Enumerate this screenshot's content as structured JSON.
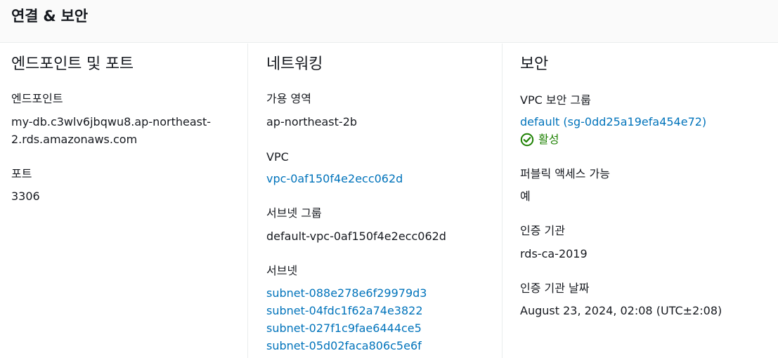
{
  "header": {
    "title": "연결 & 보안"
  },
  "endpoint_port": {
    "title": "엔드포인트 및 포트",
    "endpoint_label": "엔드포인트",
    "endpoint_value_line1": "my-db.c3wlv6jbqwu8.ap-northeast-",
    "endpoint_value_line2": "2.rds.amazonaws.com",
    "port_label": "포트",
    "port_value": "3306"
  },
  "networking": {
    "title": "네트워킹",
    "az_label": "가용 영역",
    "az_value": "ap-northeast-2b",
    "vpc_label": "VPC",
    "vpc_value": "vpc-0af150f4e2ecc062d",
    "subnet_group_label": "서브넷 그룹",
    "subnet_group_value": "default-vpc-0af150f4e2ecc062d",
    "subnets_label": "서브넷",
    "subnets": [
      "subnet-088e278e6f29979d3",
      "subnet-04fdc1f62a74e3822",
      "subnet-027f1c9fae6444ce5",
      "subnet-05d02faca806c5e6f"
    ]
  },
  "security": {
    "title": "보안",
    "vpc_sg_label": "VPC 보안 그룹",
    "vpc_sg_value": "default (sg-0dd25a19efa454e72)",
    "vpc_sg_status": "활성",
    "status_icon": "check-circle-icon",
    "status_color": "#1d8102",
    "public_access_label": "퍼블릭 액세스 가능",
    "public_access_value": "예",
    "ca_label": "인증 기관",
    "ca_value": "rds-ca-2019",
    "ca_date_label": "인증 기관 날짜",
    "ca_date_value": "August 23, 2024, 02:08 (UTC±2:08)"
  },
  "colors": {
    "link": "#0073bb",
    "text": "#16191f",
    "header_bg": "#fafafa",
    "divider": "#eaeded"
  }
}
